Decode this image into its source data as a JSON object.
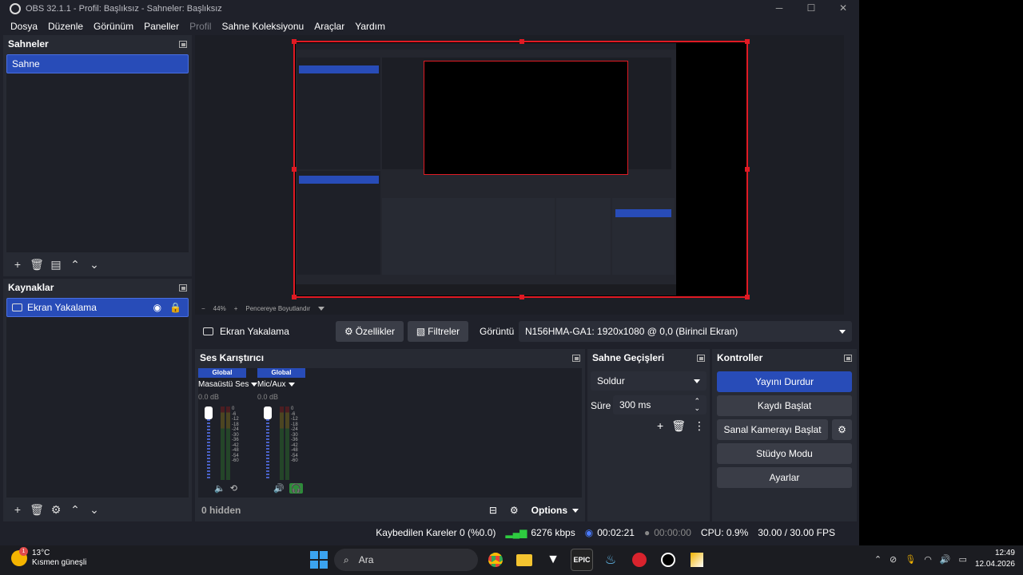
{
  "window": {
    "title": "OBS 32.1.1 - Profil: Başlıksız - Sahneler: Başlıksız"
  },
  "menu": [
    "Dosya",
    "Düzenle",
    "Görünüm",
    "Paneller",
    "Profil",
    "Sahne Koleksiyonu",
    "Araçlar",
    "Yardım"
  ],
  "scenes": {
    "title": "Sahneler",
    "items": [
      "Sahne"
    ]
  },
  "sources": {
    "title": "Kaynaklar",
    "items": [
      "Ekran Yakalama"
    ]
  },
  "zoom": {
    "level": "44%",
    "mode": "Pencereye Boyutlandır"
  },
  "source_toolbar": {
    "name": "Ekran Yakalama",
    "properties": "Özellikler",
    "filters": "Filtreler",
    "display_label": "Görüntü",
    "display_value": "N156HMA-GA1: 1920x1080 @ 0,0 (Birincil Ekran)"
  },
  "mixer": {
    "title": "Ses Karıştırıcı",
    "channels": [
      {
        "scope": "Global",
        "name": "Masaüstü Ses",
        "db": "0.0 dB"
      },
      {
        "scope": "Global",
        "name": "Mic/Aux",
        "db": "0.0 dB"
      }
    ],
    "scale": [
      "0",
      "-6",
      "-12",
      "-18",
      "-24",
      "-30",
      "-36",
      "-42",
      "-48",
      "-54",
      "-60"
    ],
    "hidden": "0 hidden",
    "options": "Options"
  },
  "transitions": {
    "title": "Sahne Geçişleri",
    "type": "Soldur",
    "duration_label": "Süre",
    "duration": "300 ms"
  },
  "controls": {
    "title": "Kontroller",
    "stop_stream": "Yayını Durdur",
    "start_record": "Kaydı Başlat",
    "virtual_cam": "Sanal Kamerayı Başlat",
    "studio": "Stüdyo Modu",
    "settings": "Ayarlar"
  },
  "status": {
    "dropped": "Kaybedilen Kareler 0 (%0.0)",
    "bitrate": "6276 kbps",
    "stream_time": "00:02:21",
    "rec_time": "00:00:00",
    "cpu": "CPU: 0.9%",
    "fps": "30.00 / 30.00 FPS"
  },
  "taskbar": {
    "temp": "13°C",
    "weather": "Kısmen güneşli",
    "weather_badge": "1",
    "search": "Ara",
    "time": "12:49",
    "date": "12.04.2026",
    "epic": "EPIC"
  },
  "colors": {
    "accent": "#284cb8",
    "bg": "#1f212a",
    "dock": "#272a33",
    "recording_border": "#e01a23"
  }
}
